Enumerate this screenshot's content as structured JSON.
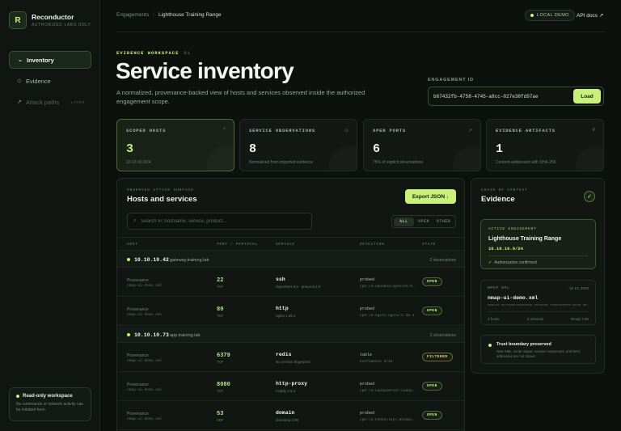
{
  "brand": {
    "name": "Reconductor",
    "tagline": "AUTHORIZED LABS ONLY",
    "logo": "R"
  },
  "sidebar": {
    "items": [
      {
        "label": "Inventory",
        "icon": "terminal-icon",
        "active": true
      },
      {
        "label": "Evidence",
        "icon": "diamond-icon",
        "active": false
      },
      {
        "label": "Attack paths",
        "icon": "arrow-up-right-icon",
        "badge": "LATER",
        "disabled": true
      }
    ],
    "readonly": {
      "title": "Read-only workspace",
      "desc": "No commands or network activity can be initiated here."
    }
  },
  "topbar": {
    "breadcrumb": [
      "Engagements",
      "Lighthouse Training Range"
    ],
    "demo_badge": "LOCAL DEMO",
    "api_link": "API docs ↗"
  },
  "header": {
    "eyebrow": "EVIDENCE WORKSPACE",
    "eyebrow_num": "01",
    "title": "Service inventory",
    "desc": "A normalized, provenance-backed view of hosts and services observed inside the authorized engagement scope.",
    "engagement_label": "ENGAGEMENT ID",
    "engagement_id": "b67432fb-4758-4745-a8cc-027e38fd97ae",
    "load_label": "Load"
  },
  "stats": [
    {
      "label": "SCOPED HOSTS",
      "icon": "^",
      "value": "3",
      "sub": "10.10.10.0/24",
      "active": true
    },
    {
      "label": "SERVICE OBSERVATIONS",
      "icon": "◇",
      "value": "8",
      "sub": "Normalized from imported evidence"
    },
    {
      "label": "OPEN PORTS",
      "icon": "↗",
      "value": "6",
      "sub": "75% of explicit observations"
    },
    {
      "label": "EVIDENCE ARTIFACTS",
      "icon": "#",
      "value": "1",
      "sub": "Content-addressed with SHA-256"
    }
  ],
  "hosts": {
    "eyebrow": "OBSERVED ATTACK SURFACE",
    "title": "Hosts and services",
    "export_label": "Export JSON ↓",
    "search_placeholder": "Search IP, hostname, service, product...",
    "filters": [
      "ALL",
      "OPEN",
      "OTHER"
    ],
    "columns": [
      "HOST",
      "PORT / PROTOCOL",
      "SERVICE",
      "DETECTION",
      "STATE"
    ],
    "groups": [
      {
        "ip": "10.10.10.42",
        "hostname": "gateway.training.lab",
        "count": "2 observations",
        "rows": [
          {
            "prov": "Provenance",
            "file": "nmap-ui-demo.xml",
            "port": "22",
            "proto": "TCP",
            "service": "ssh",
            "version": "OpenSSH 9.6 · protocol 2.0",
            "detection": "probed",
            "cpe": "cpe:/a:openbsd:openssh:9.6",
            "state": "OPEN"
          },
          {
            "prov": "Provenance",
            "file": "nmap-ui-demo.xml",
            "port": "80",
            "proto": "TCP",
            "service": "http",
            "version": "nginx 1.26.1",
            "detection": "probed",
            "cpe": "cpe:/a:nginx:nginx:1.26.1",
            "state": "OPEN"
          }
        ]
      },
      {
        "ip": "10.10.10.73",
        "hostname": "app.training.lab",
        "count": "3 observations",
        "rows": [
          {
            "prov": "Provenance",
            "file": "nmap-ui-demo.xml",
            "port": "6379",
            "proto": "TCP",
            "service": "redis",
            "version": "No version fingerprint",
            "detection": "table",
            "cpe": "Confidence 3/10",
            "state": "FILTERED"
          },
          {
            "prov": "Provenance",
            "file": "nmap-ui-demo.xml",
            "port": "8080",
            "proto": "TCP",
            "service": "http-proxy",
            "version": "Caddy 2.8.4",
            "detection": "probed",
            "cpe": "cpe:/a:caddyserver:caddy:2.8.4",
            "state": "OPEN"
          },
          {
            "prov": "Provenance",
            "file": "nmap-ui-demo.xml",
            "port": "53",
            "proto": "UDP",
            "service": "domain",
            "version": "dnsmasq 2.90",
            "detection": "probed",
            "cpe": "cpe:/a:thekelleys:dnsmasq:2.90",
            "state": "OPEN"
          }
        ]
      }
    ]
  },
  "evidence": {
    "eyebrow": "CHAIN OF CONTEXT",
    "title": "Evidence",
    "active": {
      "eyebrow": "ACTIVE ENGAGEMENT",
      "name": "Lighthouse Training Range",
      "scope": "10.10.10.0/24",
      "confirm": "Authorization confirmed"
    },
    "nmap": {
      "eyebrow": "NMAP XML",
      "date": "Jul 12, 2026",
      "file": "nmap-ui-demo.xml",
      "hash": "0ba25b 467ed8a7883e4c68 bb5d488 fe8648080ec7acd8 6e1f",
      "hosts": "3 hosts",
      "services": "8 services",
      "version": "Nmap 7.95"
    },
    "trust": {
      "title": "Trust boundary preserved",
      "desc": "Raw XML, script output, scanner arguments, and MAC addresses are not shown."
    }
  }
}
